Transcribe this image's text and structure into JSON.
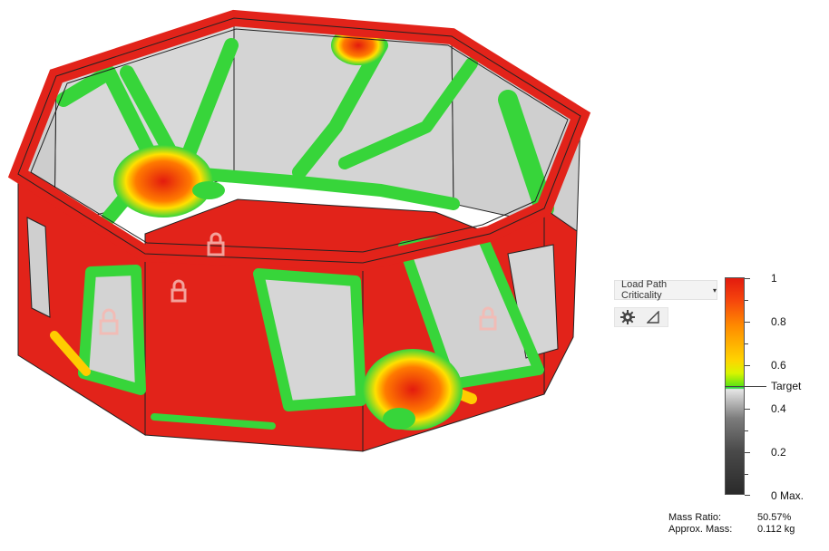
{
  "viewport": {
    "model": "octagonal-ring-shape-optimization-result"
  },
  "dropdown": {
    "label": "Load Path Criticality",
    "caret": "▾"
  },
  "toolbar": {
    "settings_icon": "gear-icon",
    "section_icon": "triangle-icon"
  },
  "legend": {
    "labels": {
      "v1": "1",
      "v08": "0.8",
      "v06": "0.6",
      "target": "Target",
      "v04": "0.4",
      "v02": "0.2",
      "v0": "0 Max."
    },
    "colors": {
      "high": "#e31b0e",
      "mid": "#ffd400",
      "target": "#33d93a",
      "low": "#2a2a2a"
    }
  },
  "stats": {
    "mass_ratio_label": "Mass Ratio:",
    "mass_ratio_value": "50.57%",
    "approx_mass_label": "Approx. Mass:",
    "approx_mass_value": "0.112 kg"
  },
  "colors": {
    "critical": "#e31b0e",
    "mid": "#f7c600",
    "low": "#37d53a",
    "wall": "#d9d9d9"
  }
}
